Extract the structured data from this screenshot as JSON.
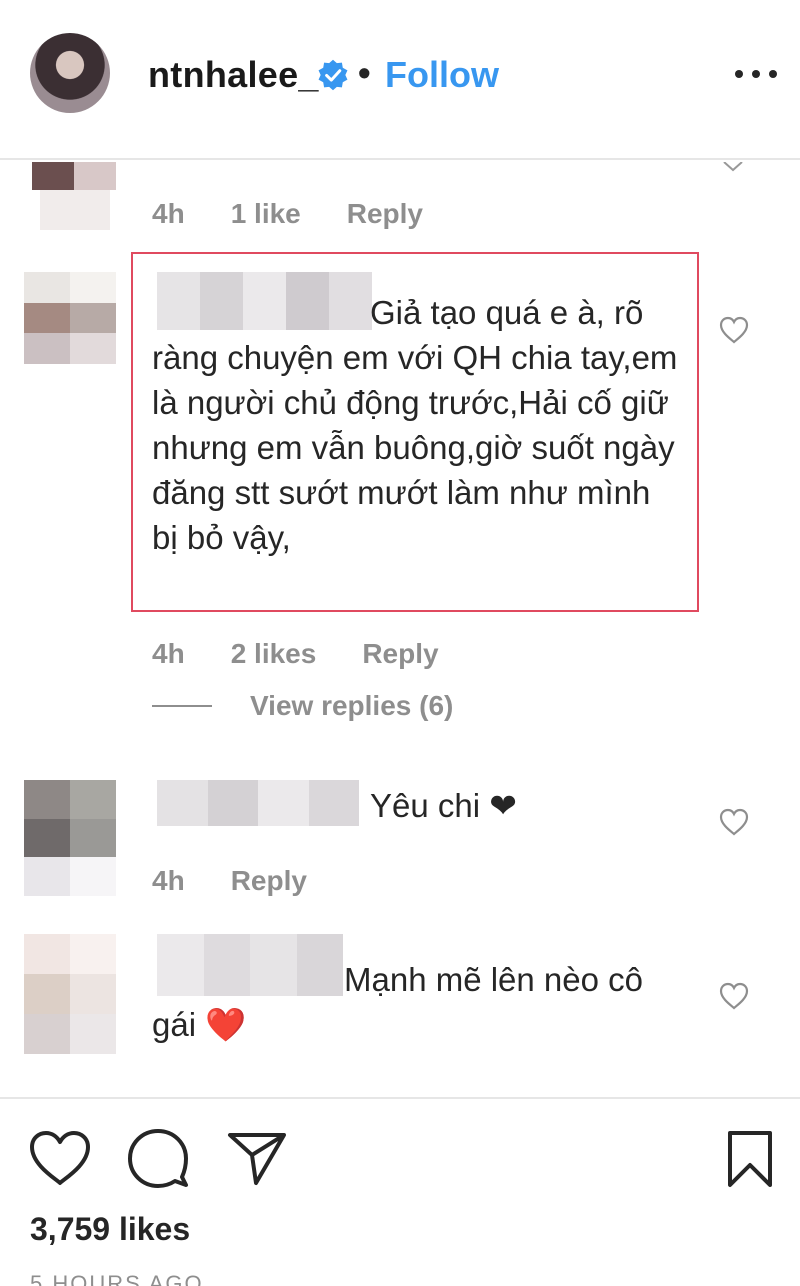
{
  "header": {
    "username": "ntnhalee_",
    "separator": "•",
    "follow_label": "Follow"
  },
  "comments": [
    {
      "meta": {
        "time": "4h",
        "likes": "1 like",
        "reply": "Reply"
      }
    },
    {
      "text": "Giả tạo quá e à, rõ ràng chuyện em với QH chia tay,em là người chủ động trước,Hải cố giữ nhưng em vẫn buông,giờ suốt ngày đăng stt sướt mướt làm như mình bị bỏ vậy,",
      "meta": {
        "time": "4h",
        "likes": "2 likes",
        "reply": "Reply"
      },
      "view_replies": "View replies (6)"
    },
    {
      "text": "Yêu chi ❤",
      "meta": {
        "time": "4h",
        "reply": "Reply"
      }
    },
    {
      "text": "Mạnh mẽ lên nèo cô gái ❤️"
    }
  ],
  "footer": {
    "likes": "3,759 likes",
    "time_ago": "5 HOURS AGO"
  },
  "colors": {
    "accent": "#3897f0",
    "highlight_border": "#e04a5f",
    "muted_text": "#8e8e8e"
  },
  "icons": [
    "verified-badge-icon",
    "more-options-icon",
    "heart-icon",
    "comment-icon",
    "share-icon",
    "bookmark-icon"
  ]
}
